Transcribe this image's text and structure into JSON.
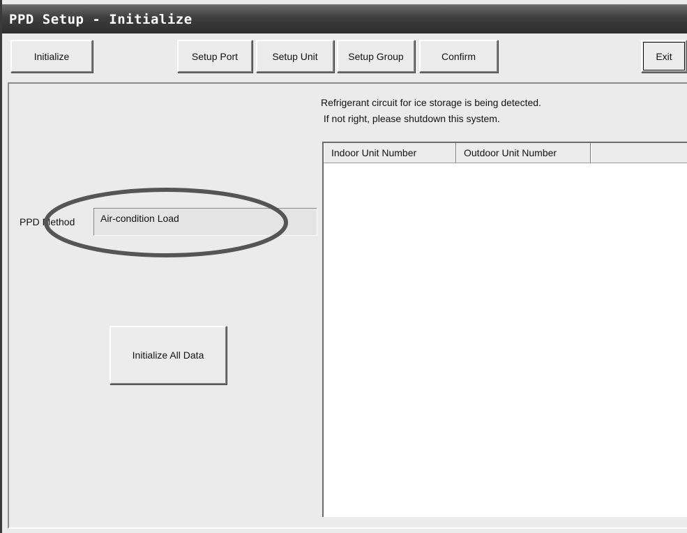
{
  "window": {
    "title": "PPD Setup - Initialize"
  },
  "toolbar": {
    "initialize": "Initialize",
    "setup_port": "Setup Port",
    "setup_unit": "Setup Unit",
    "setup_group": "Setup Group",
    "confirm": "Confirm",
    "exit": "Exit"
  },
  "main": {
    "message_line1": "Refrigerant circuit for ice storage is being detected.",
    "message_line2": " If not right, please shutdown this system.",
    "ppd_method_label": "PPD Method",
    "ppd_method_value": "Air-condition Load",
    "initialize_all_button": "Initialize All Data"
  },
  "unit_list": {
    "columns": [
      "Indoor Unit Number",
      "Outdoor Unit Number"
    ],
    "rows": []
  },
  "annotation": {
    "ellipse_color": "#555555"
  }
}
